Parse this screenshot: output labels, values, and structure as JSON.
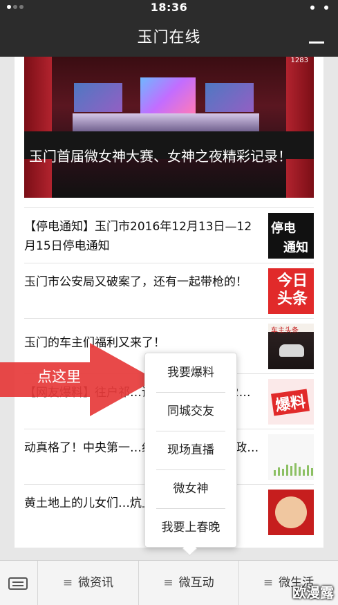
{
  "status_bar": {
    "time": "18:36"
  },
  "header": {
    "title": "玉门在线"
  },
  "hero": {
    "caption": "玉门首届微女神大赛、女神之夜精彩记录！",
    "view_count": "1283"
  },
  "articles": [
    {
      "title": "【停电通知】玉门市2016年12月13日—12月15日停电通知",
      "thumb_text_1": "停电",
      "thumb_text_2": "通知"
    },
    {
      "title": "玉门市公安局又破案了，还有一起带枪的！",
      "thumb_text": "今日头条"
    },
    {
      "title": "玉门的车主们福利又来了！",
      "thumb_text": "车主头条"
    },
    {
      "title": "【网友爆料】往户祁…谁负责？（内附12…",
      "thumb_text": "爆料"
    },
    {
      "title": "动真格了！中央第一…组进驻甘肃9天 行政…"
    },
    {
      "title": "黄土地上的儿女们…炕上的炕围子吗？"
    }
  ],
  "overlay": {
    "arrow_label": "点这里"
  },
  "popup_menu": {
    "items": [
      "我要爆料",
      "同城交友",
      "现场直播",
      "微女神",
      "我要上春晚"
    ]
  },
  "tab_bar": {
    "tabs": [
      "微资讯",
      "微互动",
      "微生活"
    ]
  },
  "watermark": "欧漫露"
}
